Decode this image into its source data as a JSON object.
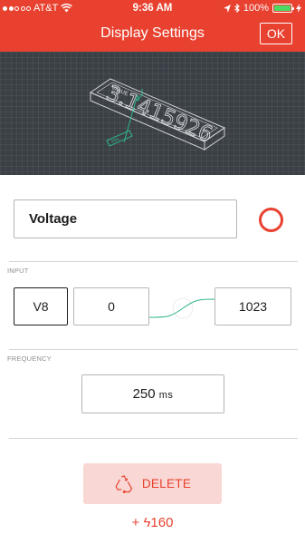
{
  "status_bar": {
    "carrier": "AT&T",
    "time": "9:36 AM",
    "battery": "100%",
    "battery_level": 1.0
  },
  "nav": {
    "title": "Display Settings",
    "ok_label": "OK"
  },
  "preview": {
    "widget_label": "VALUE",
    "widget_value": "3.1415926",
    "pin_label": "PIN"
  },
  "widget": {
    "name": "Voltage",
    "color": "#e8412f"
  },
  "input": {
    "section_label": "INPUT",
    "pin": "V8",
    "min": "0",
    "max": "1023"
  },
  "frequency": {
    "section_label": "FREQUENCY",
    "value": "250",
    "unit": "ms"
  },
  "delete": {
    "label": "DELETE"
  },
  "energy": {
    "value": "+ ϟ160"
  },
  "colors": {
    "accent": "#e8412f",
    "delete_bg": "#f9d7d4",
    "preview_bg": "#3b4046",
    "connector": "#2fb48d"
  }
}
